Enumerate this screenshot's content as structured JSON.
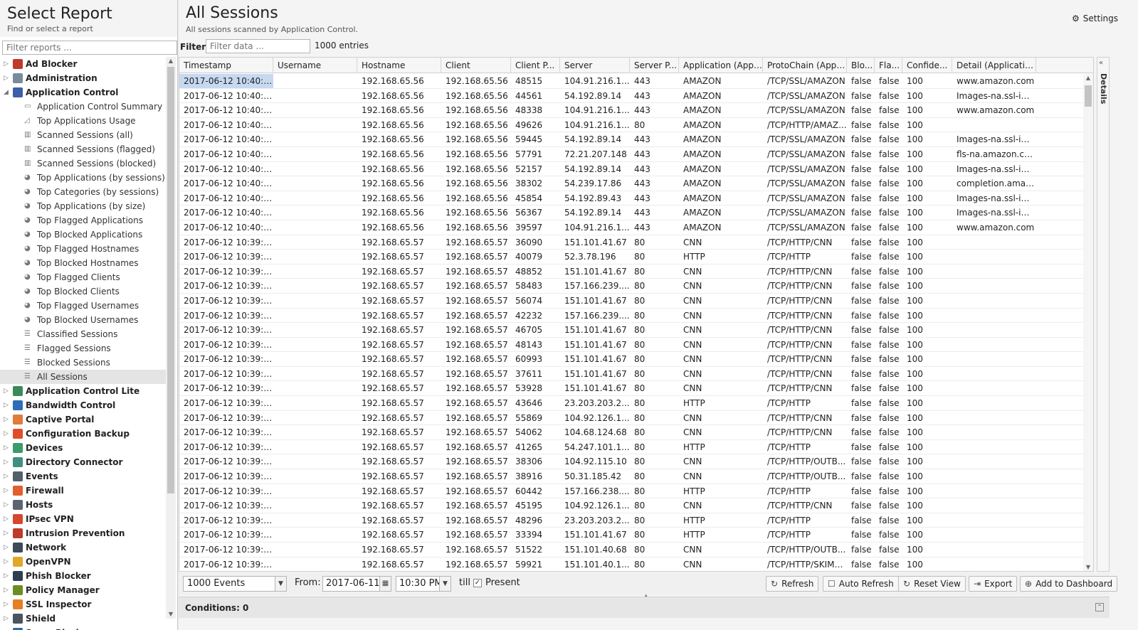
{
  "left": {
    "title": "Select Report",
    "subtitle": "Find or select a report",
    "filter_placeholder": "Filter reports ..."
  },
  "tree": [
    {
      "label": "Ad Blocker",
      "level": 0,
      "toggle": "▷",
      "icon_color": "#c0392b",
      "icon": "ad-blocker-icon"
    },
    {
      "label": "Administration",
      "level": 0,
      "toggle": "▷",
      "icon_color": "#7a8b99",
      "icon": "administration-icon"
    },
    {
      "label": "Application Control",
      "level": 0,
      "toggle": "◢",
      "icon_color": "#3b5fa8",
      "icon": "application-control-icon"
    },
    {
      "label": "Application Control Summary",
      "level": 1,
      "ricon": "▭",
      "icon": "text-report-icon"
    },
    {
      "label": "Top Applications Usage",
      "level": 1,
      "ricon": "◿",
      "icon": "area-chart-icon"
    },
    {
      "label": "Scanned Sessions (all)",
      "level": 1,
      "ricon": "▥",
      "icon": "bar-chart-icon"
    },
    {
      "label": "Scanned Sessions (flagged)",
      "level": 1,
      "ricon": "▥",
      "icon": "bar-chart-icon"
    },
    {
      "label": "Scanned Sessions (blocked)",
      "level": 1,
      "ricon": "▥",
      "icon": "bar-chart-icon"
    },
    {
      "label": "Top Applications (by sessions)",
      "level": 1,
      "ricon": "◕",
      "icon": "pie-chart-icon"
    },
    {
      "label": "Top Categories (by sessions)",
      "level": 1,
      "ricon": "◕",
      "icon": "pie-chart-icon"
    },
    {
      "label": "Top Applications (by size)",
      "level": 1,
      "ricon": "◕",
      "icon": "pie-chart-icon"
    },
    {
      "label": "Top Flagged Applications",
      "level": 1,
      "ricon": "◕",
      "icon": "pie-chart-icon"
    },
    {
      "label": "Top Blocked Applications",
      "level": 1,
      "ricon": "◕",
      "icon": "pie-chart-icon"
    },
    {
      "label": "Top Flagged Hostnames",
      "level": 1,
      "ricon": "◕",
      "icon": "pie-chart-icon"
    },
    {
      "label": "Top Blocked Hostnames",
      "level": 1,
      "ricon": "◕",
      "icon": "pie-chart-icon"
    },
    {
      "label": "Top Flagged Clients",
      "level": 1,
      "ricon": "◕",
      "icon": "pie-chart-icon"
    },
    {
      "label": "Top Blocked Clients",
      "level": 1,
      "ricon": "◕",
      "icon": "pie-chart-icon"
    },
    {
      "label": "Top Flagged Usernames",
      "level": 1,
      "ricon": "◕",
      "icon": "pie-chart-icon"
    },
    {
      "label": "Top Blocked Usernames",
      "level": 1,
      "ricon": "◕",
      "icon": "pie-chart-icon"
    },
    {
      "label": "Classified Sessions",
      "level": 1,
      "ricon": "☰",
      "icon": "list-icon"
    },
    {
      "label": "Flagged Sessions",
      "level": 1,
      "ricon": "☰",
      "icon": "list-icon"
    },
    {
      "label": "Blocked Sessions",
      "level": 1,
      "ricon": "☰",
      "icon": "list-icon"
    },
    {
      "label": "All Sessions",
      "level": 1,
      "ricon": "☰",
      "icon": "list-icon",
      "selected": true
    },
    {
      "label": "Application Control Lite",
      "level": 0,
      "toggle": "▷",
      "icon_color": "#3b8a5a",
      "icon": "application-control-lite-icon"
    },
    {
      "label": "Bandwidth Control",
      "level": 0,
      "toggle": "▷",
      "icon_color": "#2f6db5",
      "icon": "bandwidth-control-icon"
    },
    {
      "label": "Captive Portal",
      "level": 0,
      "toggle": "▷",
      "icon_color": "#e07b39",
      "icon": "captive-portal-icon"
    },
    {
      "label": "Configuration Backup",
      "level": 0,
      "toggle": "▷",
      "icon_color": "#e04e2a",
      "icon": "configuration-backup-icon"
    },
    {
      "label": "Devices",
      "level": 0,
      "toggle": "▷",
      "icon_color": "#3a9b6b",
      "icon": "devices-icon"
    },
    {
      "label": "Directory Connector",
      "level": 0,
      "toggle": "▷",
      "icon_color": "#3f8f82",
      "icon": "directory-connector-icon"
    },
    {
      "label": "Events",
      "level": 0,
      "toggle": "▷",
      "icon_color": "#555f6a",
      "icon": "events-icon"
    },
    {
      "label": "Firewall",
      "level": 0,
      "toggle": "▷",
      "icon_color": "#e35d2f",
      "icon": "firewall-icon"
    },
    {
      "label": "Hosts",
      "level": 0,
      "toggle": "▷",
      "icon_color": "#5b6470",
      "icon": "hosts-icon"
    },
    {
      "label": "IPsec VPN",
      "level": 0,
      "toggle": "▷",
      "icon_color": "#d6472c",
      "icon": "ipsec-vpn-icon"
    },
    {
      "label": "Intrusion Prevention",
      "level": 0,
      "toggle": "▷",
      "icon_color": "#c0392b",
      "icon": "intrusion-prevention-icon"
    },
    {
      "label": "Network",
      "level": 0,
      "toggle": "▷",
      "icon_color": "#3e4a57",
      "icon": "network-icon"
    },
    {
      "label": "OpenVPN",
      "level": 0,
      "toggle": "▷",
      "icon_color": "#e0a82a",
      "icon": "openvpn-icon"
    },
    {
      "label": "Phish Blocker",
      "level": 0,
      "toggle": "▷",
      "icon_color": "#2c3e50",
      "icon": "phish-blocker-icon"
    },
    {
      "label": "Policy Manager",
      "level": 0,
      "toggle": "▷",
      "icon_color": "#6b8e23",
      "icon": "policy-manager-icon"
    },
    {
      "label": "SSL Inspector",
      "level": 0,
      "toggle": "▷",
      "icon_color": "#e67e22",
      "icon": "ssl-inspector-icon"
    },
    {
      "label": "Shield",
      "level": 0,
      "toggle": "▷",
      "icon_color": "#4a5560",
      "icon": "shield-icon"
    },
    {
      "label": "Spam Blocker",
      "level": 0,
      "toggle": "▷",
      "icon_color": "#2d6a9f",
      "icon": "spam-blocker-icon"
    }
  ],
  "main": {
    "title": "All Sessions",
    "subtitle": "All sessions scanned by Application Control.",
    "settings_label": "Settings",
    "filter_label": "Filter:",
    "filter_placeholder": "Filter data ...",
    "entries": "1000 entries"
  },
  "columns": [
    "Timestamp",
    "Username",
    "Hostname",
    "Client",
    "Client P...",
    "Server",
    "Server P...",
    "Application (Appli...",
    "ProtoChain (Appli...",
    "Blo...",
    "Fla...",
    "Confide...",
    "Detail (Applicatio..."
  ],
  "rows": [
    [
      "2017-06-12 10:40:1...",
      "",
      "192.168.65.56",
      "192.168.65.56",
      "48515",
      "104.91.216.1...",
      "443",
      "AMAZON",
      "/TCP/SSL/AMAZON",
      "false",
      "false",
      "100",
      "www.amazon.com"
    ],
    [
      "2017-06-12 10:40:1...",
      "",
      "192.168.65.56",
      "192.168.65.56",
      "44561",
      "54.192.89.14",
      "443",
      "AMAZON",
      "/TCP/SSL/AMAZON",
      "false",
      "false",
      "100",
      "Images-na.ssl-im..."
    ],
    [
      "2017-06-12 10:40:1...",
      "",
      "192.168.65.56",
      "192.168.65.56",
      "48338",
      "104.91.216.1...",
      "443",
      "AMAZON",
      "/TCP/SSL/AMAZON",
      "false",
      "false",
      "100",
      "www.amazon.com"
    ],
    [
      "2017-06-12 10:40:1...",
      "",
      "192.168.65.56",
      "192.168.65.56",
      "49626",
      "104.91.216.1...",
      "80",
      "AMAZON",
      "/TCP/HTTP/AMAZ...",
      "false",
      "false",
      "100",
      ""
    ],
    [
      "2017-06-12 10:40:1...",
      "",
      "192.168.65.56",
      "192.168.65.56",
      "59445",
      "54.192.89.14",
      "443",
      "AMAZON",
      "/TCP/SSL/AMAZON",
      "false",
      "false",
      "100",
      "Images-na.ssl-im..."
    ],
    [
      "2017-06-12 10:40:1...",
      "",
      "192.168.65.56",
      "192.168.65.56",
      "57791",
      "72.21.207.148",
      "443",
      "AMAZON",
      "/TCP/SSL/AMAZON",
      "false",
      "false",
      "100",
      "fls-na.amazon.com"
    ],
    [
      "2017-06-12 10:40:1...",
      "",
      "192.168.65.56",
      "192.168.65.56",
      "52157",
      "54.192.89.14",
      "443",
      "AMAZON",
      "/TCP/SSL/AMAZON",
      "false",
      "false",
      "100",
      "Images-na.ssl-im..."
    ],
    [
      "2017-06-12 10:40:1...",
      "",
      "192.168.65.56",
      "192.168.65.56",
      "38302",
      "54.239.17.86",
      "443",
      "AMAZON",
      "/TCP/SSL/AMAZON",
      "false",
      "false",
      "100",
      "completion.amaz..."
    ],
    [
      "2017-06-12 10:40:1...",
      "",
      "192.168.65.56",
      "192.168.65.56",
      "45854",
      "54.192.89.43",
      "443",
      "AMAZON",
      "/TCP/SSL/AMAZON",
      "false",
      "false",
      "100",
      "Images-na.ssl-im..."
    ],
    [
      "2017-06-12 10:40:1...",
      "",
      "192.168.65.56",
      "192.168.65.56",
      "56367",
      "54.192.89.14",
      "443",
      "AMAZON",
      "/TCP/SSL/AMAZON",
      "false",
      "false",
      "100",
      "Images-na.ssl-im..."
    ],
    [
      "2017-06-12 10:40:1...",
      "",
      "192.168.65.56",
      "192.168.65.56",
      "39597",
      "104.91.216.1...",
      "443",
      "AMAZON",
      "/TCP/SSL/AMAZON",
      "false",
      "false",
      "100",
      "www.amazon.com"
    ],
    [
      "2017-06-12 10:39:5...",
      "",
      "192.168.65.57",
      "192.168.65.57",
      "36090",
      "151.101.41.67",
      "80",
      "CNN",
      "/TCP/HTTP/CNN",
      "false",
      "false",
      "100",
      ""
    ],
    [
      "2017-06-12 10:39:5...",
      "",
      "192.168.65.57",
      "192.168.65.57",
      "40079",
      "52.3.78.196",
      "80",
      "HTTP",
      "/TCP/HTTP",
      "false",
      "false",
      "100",
      ""
    ],
    [
      "2017-06-12 10:39:5...",
      "",
      "192.168.65.57",
      "192.168.65.57",
      "48852",
      "151.101.41.67",
      "80",
      "CNN",
      "/TCP/HTTP/CNN",
      "false",
      "false",
      "100",
      ""
    ],
    [
      "2017-06-12 10:39:4...",
      "",
      "192.168.65.57",
      "192.168.65.57",
      "58483",
      "157.166.239....",
      "80",
      "CNN",
      "/TCP/HTTP/CNN",
      "false",
      "false",
      "100",
      ""
    ],
    [
      "2017-06-12 10:39:4...",
      "",
      "192.168.65.57",
      "192.168.65.57",
      "56074",
      "151.101.41.67",
      "80",
      "CNN",
      "/TCP/HTTP/CNN",
      "false",
      "false",
      "100",
      ""
    ],
    [
      "2017-06-12 10:39:4...",
      "",
      "192.168.65.57",
      "192.168.65.57",
      "42232",
      "157.166.239....",
      "80",
      "CNN",
      "/TCP/HTTP/CNN",
      "false",
      "false",
      "100",
      ""
    ],
    [
      "2017-06-12 10:39:4...",
      "",
      "192.168.65.57",
      "192.168.65.57",
      "46705",
      "151.101.41.67",
      "80",
      "CNN",
      "/TCP/HTTP/CNN",
      "false",
      "false",
      "100",
      ""
    ],
    [
      "2017-06-12 10:39:4...",
      "",
      "192.168.65.57",
      "192.168.65.57",
      "48143",
      "151.101.41.67",
      "80",
      "CNN",
      "/TCP/HTTP/CNN",
      "false",
      "false",
      "100",
      ""
    ],
    [
      "2017-06-12 10:39:4...",
      "",
      "192.168.65.57",
      "192.168.65.57",
      "60993",
      "151.101.41.67",
      "80",
      "CNN",
      "/TCP/HTTP/CNN",
      "false",
      "false",
      "100",
      ""
    ],
    [
      "2017-06-12 10:39:4...",
      "",
      "192.168.65.57",
      "192.168.65.57",
      "37611",
      "151.101.41.67",
      "80",
      "CNN",
      "/TCP/HTTP/CNN",
      "false",
      "false",
      "100",
      ""
    ],
    [
      "2017-06-12 10:39:4...",
      "",
      "192.168.65.57",
      "192.168.65.57",
      "53928",
      "151.101.41.67",
      "80",
      "CNN",
      "/TCP/HTTP/CNN",
      "false",
      "false",
      "100",
      ""
    ],
    [
      "2017-06-12 10:39:4...",
      "",
      "192.168.65.57",
      "192.168.65.57",
      "43646",
      "23.203.203.2...",
      "80",
      "HTTP",
      "/TCP/HTTP",
      "false",
      "false",
      "100",
      ""
    ],
    [
      "2017-06-12 10:39:4...",
      "",
      "192.168.65.57",
      "192.168.65.57",
      "55869",
      "104.92.126.1...",
      "80",
      "CNN",
      "/TCP/HTTP/CNN",
      "false",
      "false",
      "100",
      ""
    ],
    [
      "2017-06-12 10:39:4...",
      "",
      "192.168.65.57",
      "192.168.65.57",
      "54062",
      "104.68.124.68",
      "80",
      "CNN",
      "/TCP/HTTP/CNN",
      "false",
      "false",
      "100",
      ""
    ],
    [
      "2017-06-12 10:39:4...",
      "",
      "192.168.65.57",
      "192.168.65.57",
      "41265",
      "54.247.101.1...",
      "80",
      "HTTP",
      "/TCP/HTTP",
      "false",
      "false",
      "100",
      ""
    ],
    [
      "2017-06-12 10:39:4...",
      "",
      "192.168.65.57",
      "192.168.65.57",
      "38306",
      "104.92.115.10",
      "80",
      "CNN",
      "/TCP/HTTP/OUTB...",
      "false",
      "false",
      "100",
      ""
    ],
    [
      "2017-06-12 10:39:4...",
      "",
      "192.168.65.57",
      "192.168.65.57",
      "38916",
      "50.31.185.42",
      "80",
      "CNN",
      "/TCP/HTTP/OUTB...",
      "false",
      "false",
      "100",
      ""
    ],
    [
      "2017-06-12 10:39:4...",
      "",
      "192.168.65.57",
      "192.168.65.57",
      "60442",
      "157.166.238....",
      "80",
      "HTTP",
      "/TCP/HTTP",
      "false",
      "false",
      "100",
      ""
    ],
    [
      "2017-06-12 10:39:4...",
      "",
      "192.168.65.57",
      "192.168.65.57",
      "45195",
      "104.92.126.1...",
      "80",
      "CNN",
      "/TCP/HTTP/CNN",
      "false",
      "false",
      "100",
      ""
    ],
    [
      "2017-06-12 10:39:4...",
      "",
      "192.168.65.57",
      "192.168.65.57",
      "48296",
      "23.203.203.2...",
      "80",
      "HTTP",
      "/TCP/HTTP",
      "false",
      "false",
      "100",
      ""
    ],
    [
      "2017-06-12 10:39:4...",
      "",
      "192.168.65.57",
      "192.168.65.57",
      "33394",
      "151.101.41.67",
      "80",
      "HTTP",
      "/TCP/HTTP",
      "false",
      "false",
      "100",
      ""
    ],
    [
      "2017-06-12 10:39:4...",
      "",
      "192.168.65.57",
      "192.168.65.57",
      "51522",
      "151.101.40.68",
      "80",
      "CNN",
      "/TCP/HTTP/OUTB...",
      "false",
      "false",
      "100",
      ""
    ],
    [
      "2017-06-12 10:39:4...",
      "",
      "192.168.65.57",
      "192.168.65.57",
      "59921",
      "151.101.40.1...",
      "80",
      "CNN",
      "/TCP/HTTP/SKIMLI...",
      "false",
      "false",
      "100",
      ""
    ]
  ],
  "details": {
    "label": "Details"
  },
  "toolbar": {
    "events_value": "1000 Events",
    "from_label": "From:",
    "from_date": "2017-06-11",
    "from_time": "10:30 PM",
    "till_label": "till",
    "present_label": "Present",
    "refresh": "Refresh",
    "auto_refresh": "Auto Refresh",
    "reset_view": "Reset View",
    "export": "Export",
    "add_to_dashboard": "Add to Dashboard"
  },
  "conditions": {
    "label": "Conditions: 0"
  },
  "colors": {
    "selected_row": "#c7d9f1",
    "accent": "#3b5fa8"
  }
}
